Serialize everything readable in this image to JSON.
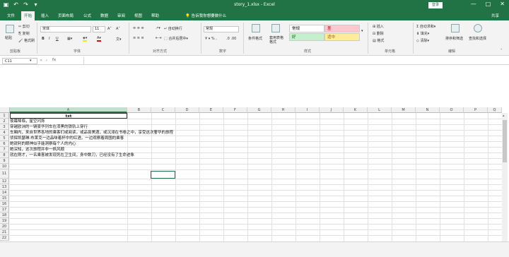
{
  "window": {
    "title": "story_1.xlsx  -  Excel",
    "login_label": "登录",
    "controls": [
      "—",
      "□",
      "✕"
    ]
  },
  "tabs": {
    "items": [
      "文件",
      "开始",
      "插入",
      "页面布局",
      "公式",
      "数据",
      "审阅",
      "视图",
      "帮助"
    ],
    "active": "开始",
    "tell_me": "告诉我你想要做什么",
    "share": "共享"
  },
  "ribbon": {
    "clipboard": {
      "paste": "粘贴",
      "cut": "剪切",
      "copy": "复制",
      "format_painter": "格式刷",
      "group": "剪贴板"
    },
    "font": {
      "name": "宋体",
      "size": "11",
      "group": "字体",
      "buttons": [
        "B",
        "I",
        "U"
      ]
    },
    "alignment": {
      "wrap": "自动换行",
      "merge": "合并后居中",
      "group": "对齐方式"
    },
    "number": {
      "format": "常规",
      "group": "数字"
    },
    "styles": {
      "conditional": "条件格式",
      "table": "套用表格格式",
      "cells": [
        {
          "label": "常规",
          "bg": "#ffffff",
          "fg": "#000000"
        },
        {
          "label": "差",
          "bg": "#ffc7ce",
          "fg": "#9c0006"
        },
        {
          "label": "好",
          "bg": "#c6efce",
          "fg": "#006100"
        },
        {
          "label": "适中",
          "bg": "#ffeb9c",
          "fg": "#9c5700"
        }
      ],
      "group": "样式"
    },
    "cells": {
      "insert": "插入",
      "delete": "删除",
      "format": "格式",
      "group": "单元格"
    },
    "editing": {
      "autosum": "自动求和",
      "fill": "填充",
      "clear": "清除",
      "sort": "排序和筛选",
      "find": "查找和选择",
      "group": "编辑"
    }
  },
  "formula_bar": {
    "name_box": "C11",
    "fx": "fx",
    "content": ""
  },
  "columns": [
    "A",
    "B",
    "C",
    "D",
    "E",
    "F",
    "G",
    "H",
    "I",
    "J",
    "K",
    "L",
    "M",
    "N",
    "O",
    "P",
    "Q"
  ],
  "selected_column": "A",
  "rows": [
    "1",
    "2",
    "3",
    "4",
    "5",
    "6",
    "7",
    "8",
    "9",
    "10",
    "11",
    "12",
    "13",
    "14",
    "15",
    "16",
    "17",
    "18",
    "19",
    "20",
    "21",
    "22"
  ],
  "cells": [
    "txt",
    "夜幕降临，星空闪烁",
    "穿越欧洲的一辆豪华列车在漆黑的铁轨上穿行",
    "车厢内，来自世界各地的乘客们或阅读，或品尝美酒，或沉浸在书卷之中，享受这次奢华的旅程",
    "侦探凯瑟琳·布莱克一边品味着杯中的红酒，一边观察着周围的乘客",
    "她锐利的眼神似乎能洞察每个人的内心",
    "她深知，这次旅程并非一帆风顺",
    "就在刚才，一名乘客被发现死在卫生间，身中数刀，已经没有了生命迹象"
  ]
}
